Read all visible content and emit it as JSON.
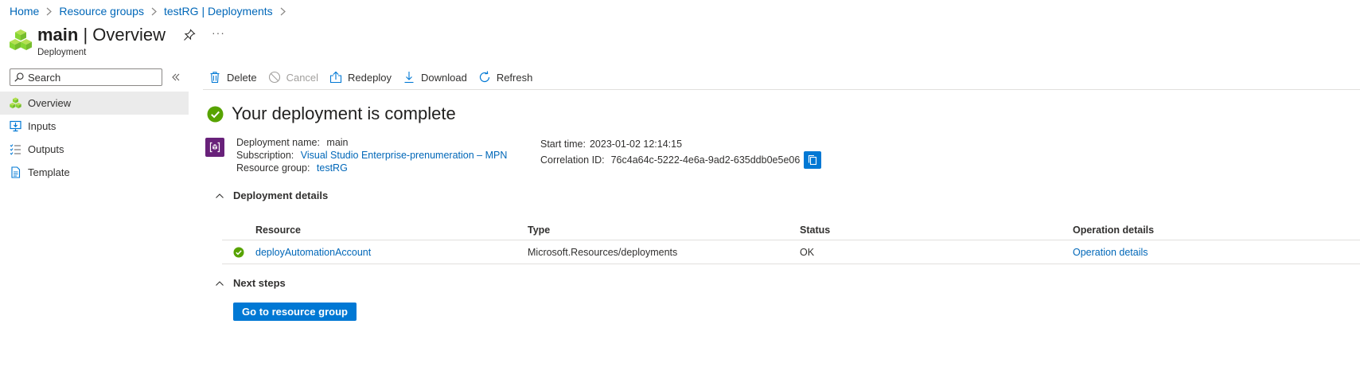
{
  "breadcrumb": {
    "items": [
      "Home",
      "Resource groups",
      "testRG | Deployments"
    ]
  },
  "header": {
    "title_bold": "main",
    "title_rest": " | Overview",
    "subtitle": "Deployment",
    "more": "···"
  },
  "sidebar": {
    "search_placeholder": "Search",
    "items": [
      {
        "label": "Overview",
        "icon": "overview-icon",
        "active": true
      },
      {
        "label": "Inputs",
        "icon": "inputs-icon"
      },
      {
        "label": "Outputs",
        "icon": "outputs-icon"
      },
      {
        "label": "Template",
        "icon": "template-icon"
      }
    ]
  },
  "toolbar": {
    "delete": "Delete",
    "cancel": "Cancel",
    "redeploy": "Redeploy",
    "download": "Download",
    "refresh": "Refresh"
  },
  "main": {
    "status_title": "Your deployment is complete",
    "info": {
      "deployment_name_label": "Deployment name:",
      "deployment_name": "main",
      "subscription_label": "Subscription:",
      "subscription": "Visual Studio Enterprise-prenumeration – MPN",
      "resource_group_label": "Resource group:",
      "resource_group": "testRG",
      "start_time_label": "Start time:",
      "start_time": "2023-01-02 12:14:15",
      "correlation_id_label": "Correlation ID:",
      "correlation_id": "76c4a64c-5222-4e6a-9ad2-635ddb0e5e06"
    },
    "deployment_details": {
      "heading": "Deployment details",
      "columns": [
        "Resource",
        "Type",
        "Status",
        "Operation details"
      ],
      "rows": [
        {
          "resource": "deployAutomationAccount",
          "type": "Microsoft.Resources/deployments",
          "status": "OK",
          "operation": "Operation details"
        }
      ]
    },
    "next_steps": {
      "heading": "Next steps",
      "button": "Go to resource group"
    }
  },
  "colors": {
    "accent": "#0078d4",
    "link": "#0067b8",
    "success": "#57a300",
    "deployment_icon_bg": "#68217a"
  }
}
